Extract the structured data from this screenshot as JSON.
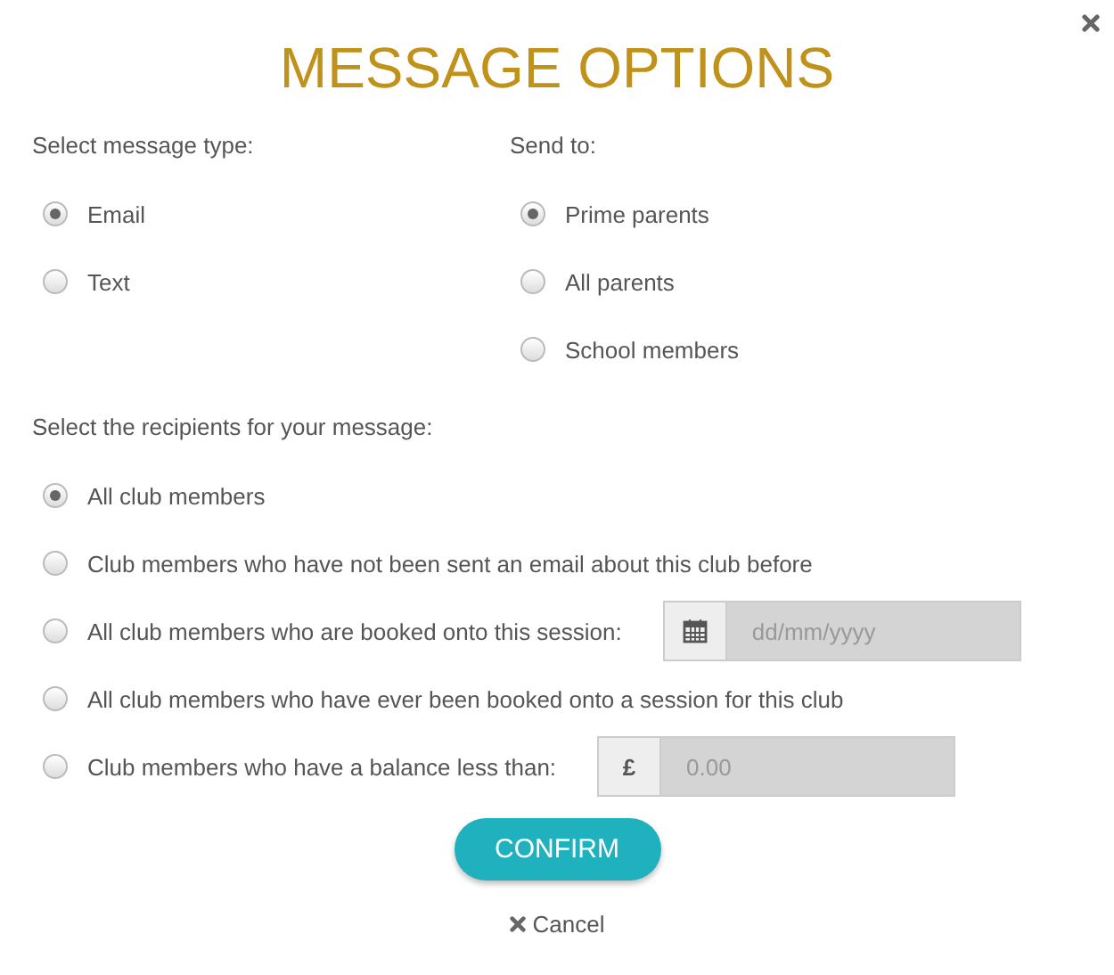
{
  "dialog": {
    "title": "MESSAGE OPTIONS"
  },
  "message_type": {
    "label": "Select message type:",
    "options": [
      {
        "label": "Email",
        "selected": true
      },
      {
        "label": "Text",
        "selected": false
      }
    ]
  },
  "send_to": {
    "label": "Send to:",
    "options": [
      {
        "label": "Prime parents",
        "selected": true
      },
      {
        "label": "All parents",
        "selected": false
      },
      {
        "label": "School members",
        "selected": false
      }
    ]
  },
  "recipients": {
    "label": "Select the recipients for your message:",
    "options": [
      {
        "kind": "plain",
        "label": "All club members",
        "selected": true
      },
      {
        "kind": "plain",
        "label": "Club members who have not been sent an email about this club before",
        "selected": false
      },
      {
        "kind": "date",
        "label": "All club members who are booked onto this session:",
        "selected": false,
        "field": {
          "placeholder": "dd/mm/yyyy",
          "disabled": true
        }
      },
      {
        "kind": "plain",
        "label": "All club members who have ever been booked onto a session for this club",
        "selected": false
      },
      {
        "kind": "amount",
        "label": "Club members who have a balance less than:",
        "selected": false,
        "field": {
          "addon": "£",
          "placeholder": "0.00",
          "disabled": true
        }
      }
    ]
  },
  "buttons": {
    "confirm": "CONFIRM",
    "cancel": "Cancel"
  }
}
